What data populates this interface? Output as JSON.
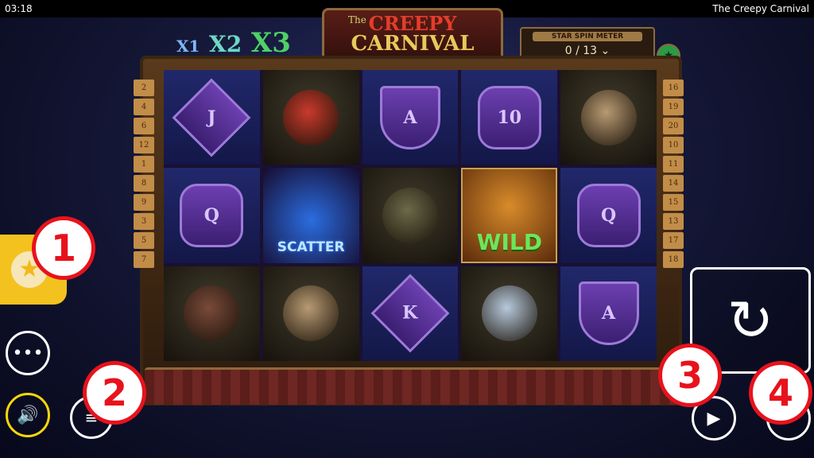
{
  "statusbar": {
    "time": "03:18",
    "app_title": "The Creepy Carnival"
  },
  "game": {
    "title_the": "The",
    "title_line1": "CREEPY",
    "title_line2": "CARNIVAL",
    "multipliers": [
      "X1",
      "X2",
      "X3"
    ],
    "star_meter_label": "STAR SPIN METER",
    "star_meter_value": "0 / 13"
  },
  "reels": [
    [
      {
        "type": "card",
        "label": "J"
      },
      {
        "type": "char",
        "label": "Clown"
      },
      {
        "type": "shield",
        "label": "A"
      },
      {
        "type": "oct",
        "label": "10"
      },
      {
        "type": "char",
        "label": "Strongman"
      }
    ],
    [
      {
        "type": "oct",
        "label": "Q"
      },
      {
        "type": "scatter",
        "label": "SCATTER"
      },
      {
        "type": "char",
        "label": "Monkey"
      },
      {
        "type": "wild",
        "label": "WILD"
      },
      {
        "type": "oct",
        "label": "Q"
      }
    ],
    [
      {
        "type": "char",
        "label": "Ringmistress"
      },
      {
        "type": "char",
        "label": "Strongman"
      },
      {
        "type": "card",
        "label": "K"
      },
      {
        "type": "char",
        "label": "Polar Bear"
      },
      {
        "type": "shield",
        "label": "A"
      }
    ]
  ],
  "paylines_left": [
    "2",
    "4",
    "6",
    "12",
    "1",
    "8",
    "9",
    "3",
    "5",
    "7"
  ],
  "paylines_right": [
    "16",
    "19",
    "20",
    "10",
    "11",
    "14",
    "15",
    "13",
    "17",
    "18"
  ],
  "annotations": [
    "1",
    "2",
    "3",
    "4"
  ],
  "icons": {
    "menu": "more-horizontal-icon",
    "sound": "volume-icon",
    "bet": "bet-icon",
    "play": "play-icon",
    "spin": "spin-refresh-icon",
    "auto": "autoplay-icon",
    "favorite": "star-icon"
  },
  "colors": {
    "accent_yellow": "#f3c21e",
    "annotation_red": "#e8121c"
  }
}
